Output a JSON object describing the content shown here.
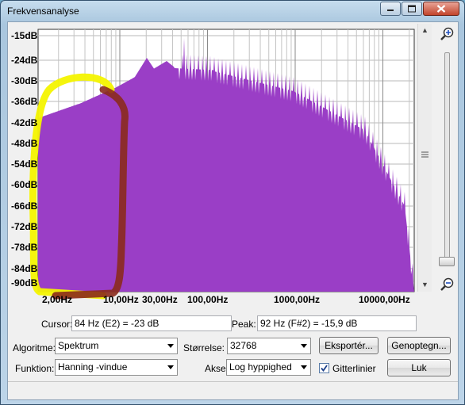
{
  "window": {
    "title": "Frekvensanalyse"
  },
  "plot": {
    "fill_color": "#9a3ec6",
    "annotation_color": "#f4f400",
    "annotation_inner_color": "#8b2a1c",
    "db_labels": [
      "-15dB",
      "-24dB",
      "-30dB",
      "-36dB",
      "-42dB",
      "-48dB",
      "-54dB",
      "-60dB",
      "-66dB",
      "-72dB",
      "-78dB",
      "-84dB",
      "-90dB"
    ],
    "hz_labels": [
      "2,00Hz",
      "10,00Hz",
      "30,00Hz",
      "100,00Hz",
      "1000,00Hz",
      "10000,00Hz"
    ]
  },
  "cursor": {
    "label": "Cursor:",
    "value": "84 Hz (E2) = -23 dB"
  },
  "peak": {
    "label": "Peak:",
    "value": "92 Hz (F#2) = -15,9 dB"
  },
  "algorithm": {
    "label": "Algoritme:",
    "value": "Spektrum"
  },
  "size": {
    "label": "Størrelse:",
    "value": "32768"
  },
  "function": {
    "label": "Funktion:",
    "value": "Hanning -vindue"
  },
  "axis": {
    "label": "Akse",
    "value": "Log hyppighed"
  },
  "gridlines": {
    "label": "Gitterlinier",
    "checked": true
  },
  "buttons": {
    "export": "Eksportér...",
    "replot": "Genoptegn...",
    "close": "Luk"
  }
}
